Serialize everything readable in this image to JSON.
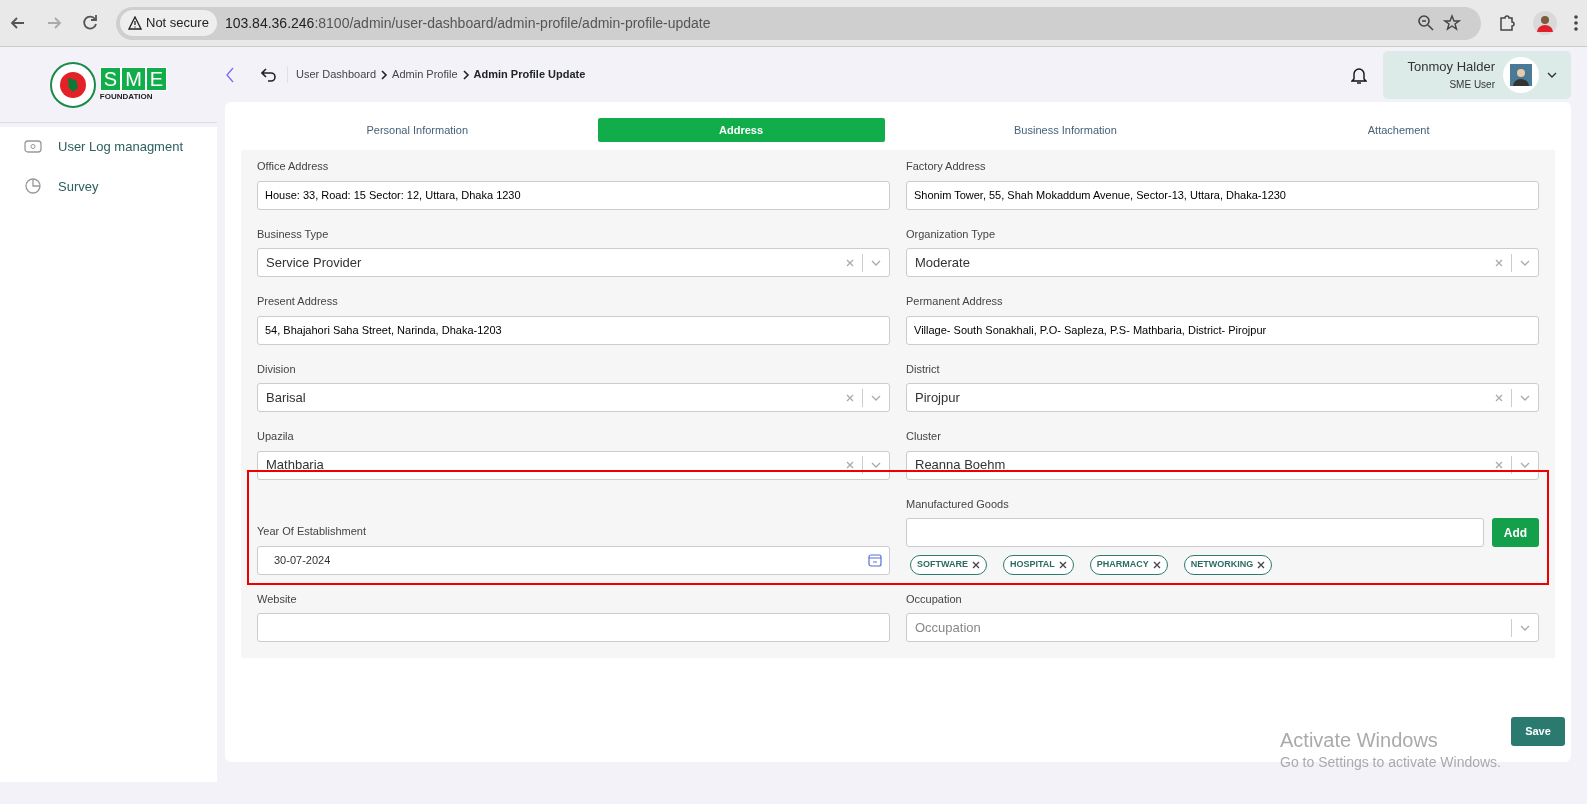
{
  "browser": {
    "security": "Not secure",
    "url_host": "103.84.36.246",
    "url_path": ":8100/admin/user-dashboard/admin-profile/admin-profile-update"
  },
  "sidebar": {
    "logo_text": "FOUNDATION",
    "logo_letters": [
      "S",
      "M",
      "E"
    ],
    "items": [
      {
        "label": "User Log managment",
        "selected": false
      },
      {
        "label": "Survey",
        "selected": false
      }
    ]
  },
  "breadcrumb": [
    {
      "label": "User Dashboard",
      "current": false
    },
    {
      "label": "Admin Profile",
      "current": false
    },
    {
      "label": "Admin Profile Update",
      "current": true
    }
  ],
  "user": {
    "name": "Tonmoy Halder",
    "role": "SME User"
  },
  "tabs": [
    {
      "label": "Personal Information",
      "selected": false
    },
    {
      "label": "Address",
      "selected": true
    },
    {
      "label": "Business Information",
      "selected": false
    },
    {
      "label": "Attachement",
      "selected": false
    }
  ],
  "rows": [
    {
      "highlighted": false,
      "fields": [
        {
          "kind": "text",
          "label": "Office Address",
          "value": "House: 33, Road: 15 Sector: 12, Uttara, Dhaka 1230"
        },
        {
          "kind": "text",
          "label": "Factory Address",
          "value": "Shonim Tower, 55, Shah Mokaddum Avenue, Sector-13, Uttara, Dhaka-1230"
        }
      ]
    },
    {
      "highlighted": false,
      "fields": [
        {
          "kind": "select",
          "label": "Business Type",
          "value": "Service Provider"
        },
        {
          "kind": "select",
          "label": "Organization Type",
          "value": "Moderate"
        }
      ]
    },
    {
      "highlighted": false,
      "fields": [
        {
          "kind": "text",
          "label": "Present Address",
          "value": "54, Bhajahori Saha Street, Narinda, Dhaka-1203"
        },
        {
          "kind": "text",
          "label": "Permanent Address",
          "value": "Village- South Sonakhali, P.O- Sapleza, P.S- Mathbaria, District- Pirojpur"
        }
      ]
    },
    {
      "highlighted": false,
      "fields": [
        {
          "kind": "select",
          "label": "Division",
          "value": "Barisal"
        },
        {
          "kind": "select",
          "label": "District",
          "value": "Pirojpur"
        }
      ]
    },
    {
      "highlighted": false,
      "fields": [
        {
          "kind": "select",
          "label": "Upazila",
          "value": "Mathbaria"
        },
        {
          "kind": "select",
          "label": "Cluster",
          "value": "Reanna Boehm"
        }
      ]
    },
    {
      "highlighted": true,
      "fields": [
        {
          "kind": "date",
          "label": "Year Of Establishment",
          "value": "30-07-2024"
        },
        {
          "kind": "tags",
          "label": "Manufactured Goods",
          "button": "Add",
          "tags": [
            "SOFTWARE",
            "HOSPITAL",
            "PHARMACY",
            "NETWORKING"
          ]
        }
      ]
    },
    {
      "highlighted": false,
      "fields": [
        {
          "kind": "text",
          "label": "Website"
        },
        {
          "kind": "select",
          "label": "Occupation",
          "placeholder": "Occupation"
        }
      ]
    }
  ],
  "save_button": "Save",
  "os_notice": {
    "title": "Activate Windows",
    "text": "Go to Settings to activate Windows."
  }
}
